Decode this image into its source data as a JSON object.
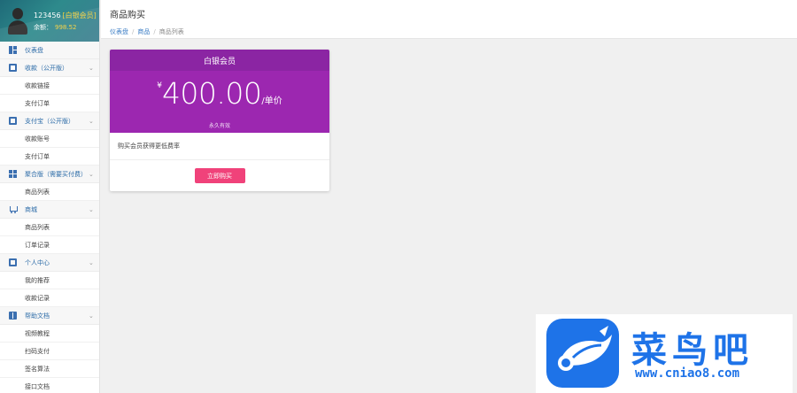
{
  "sidebar": {
    "user": {
      "name": "123456",
      "level": "[白银会员]",
      "balance_label": "余额：",
      "balance": "998.52"
    },
    "menu": [
      {
        "label": "仪表盘",
        "icon": "dashboard-icon",
        "expandable": false
      },
      {
        "label": "收款（公开版）",
        "icon": "card-icon",
        "expandable": true
      },
      {
        "label": "收款链接",
        "sub": true
      },
      {
        "label": "支付订单",
        "sub": true
      },
      {
        "label": "支付宝（公开版）",
        "icon": "wallet-icon",
        "expandable": true
      },
      {
        "label": "收款账号",
        "sub": true
      },
      {
        "label": "支付订单",
        "sub": true
      },
      {
        "label": "聚合版（需要买付费）",
        "icon": "grid-icon",
        "expandable": true
      },
      {
        "label": "商品列表",
        "sub": true
      },
      {
        "label": "商城",
        "icon": "cart-icon",
        "expandable": true
      },
      {
        "label": "商品列表",
        "sub": true
      },
      {
        "label": "订单记录",
        "sub": true
      },
      {
        "label": "个人中心",
        "icon": "wallet-icon",
        "expandable": true
      },
      {
        "label": "我的推荐",
        "sub": true
      },
      {
        "label": "收款记录",
        "sub": true
      },
      {
        "label": "帮助文档",
        "icon": "book-icon",
        "expandable": true
      },
      {
        "label": "视频教程",
        "sub": true
      },
      {
        "label": "扫码支付",
        "sub": true
      },
      {
        "label": "签名算法",
        "sub": true
      },
      {
        "label": "接口文档",
        "sub": true
      }
    ]
  },
  "header": {
    "title": "商品购买",
    "breadcrumb": [
      "仪表盘",
      "商品",
      "商品列表"
    ]
  },
  "product": {
    "name": "白银会员",
    "currency": "¥",
    "price": "400.00",
    "unit": "/单价",
    "desc": "永久有效",
    "note": "购买会员获得更低费率",
    "buy_label": "立即购买"
  },
  "watermark": {
    "brand": "菜鸟吧",
    "url": "www.cniao8.com"
  },
  "colors": {
    "card_header": "#8b25a3",
    "card_body": "#9c27b0",
    "buy_button": "#f0427a",
    "brand_blue": "#1e73e8"
  }
}
